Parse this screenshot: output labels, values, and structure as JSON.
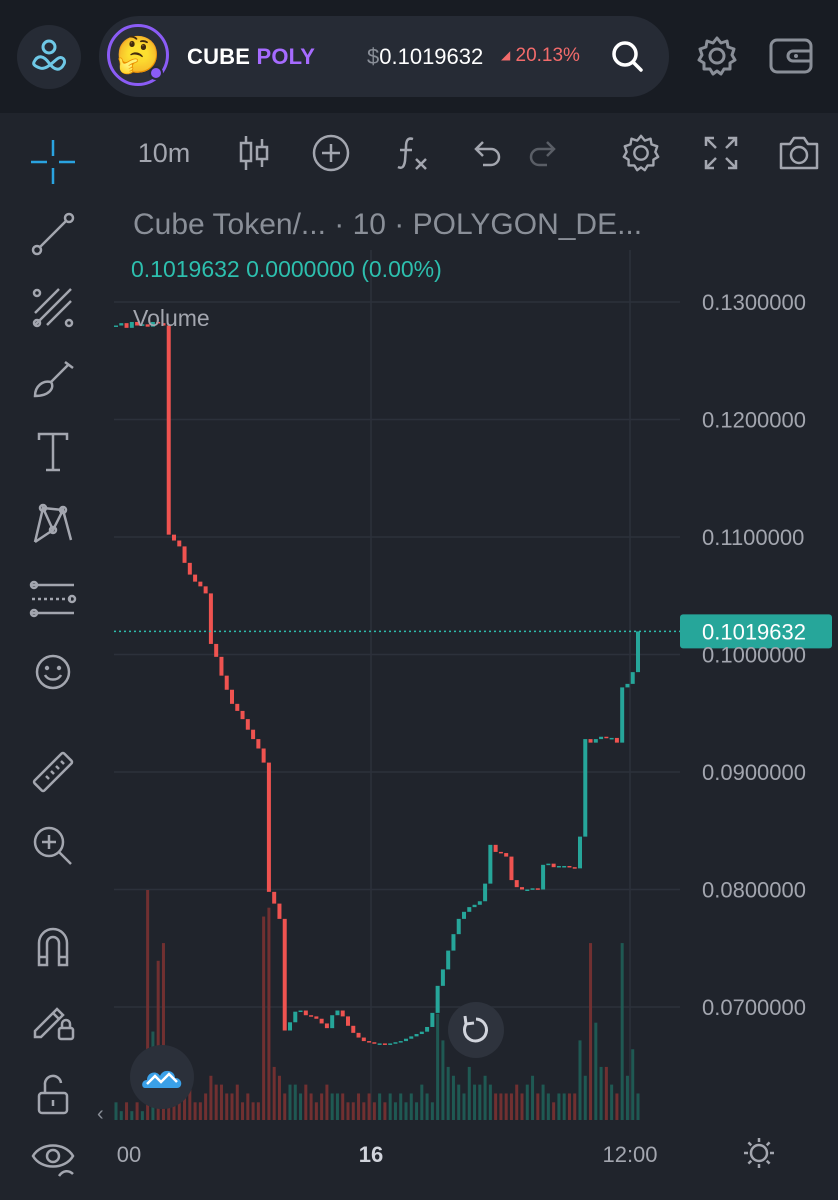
{
  "header": {
    "token_symbol": "CUBE",
    "token_chain": "POLY",
    "price_currency": "$",
    "price": "0.1019632",
    "change_arrow": "◢",
    "change": "20.13%",
    "avatar_emoji": "🤔"
  },
  "toolbar": {
    "interval": "10m"
  },
  "chart_header": {
    "title": "Cube Token/...  ·  10  ·  POLYGON_DE...",
    "ohlc": "0.1019632  0.0000000 (0.00%)",
    "volume_label": "Volume"
  },
  "chart_data": {
    "type": "candlestick",
    "pair_label": "Cube Token/...",
    "interval": "10",
    "exchange": "POLYGON_DE...",
    "last_price": "0.1019632",
    "last_price_value": 0.1019632,
    "ylim": [
      0.0625,
      0.1335
    ],
    "yticks": [
      "0.1300000",
      "0.1200000",
      "0.1100000",
      "0.1000000",
      "0.0900000",
      "0.0800000",
      "0.0700000"
    ],
    "ytick_values": [
      0.13,
      0.12,
      0.11,
      0.1,
      0.09,
      0.08,
      0.07
    ],
    "xticks": [
      "00",
      "16",
      "12:00"
    ],
    "xtick_bold": [
      false,
      true,
      false
    ],
    "bar_count": 100,
    "series": [
      {
        "name": "Price",
        "close": [
          0.128,
          0.1282,
          0.1278,
          0.1283,
          0.128,
          0.1281,
          0.1279,
          0.1283,
          0.1282,
          0.128,
          0.1102,
          0.1097,
          0.1092,
          0.1078,
          0.1068,
          0.1062,
          0.1058,
          0.1052,
          0.1009,
          0.0998,
          0.0982,
          0.097,
          0.0958,
          0.0952,
          0.0945,
          0.0936,
          0.0928,
          0.092,
          0.0908,
          0.0798,
          0.0788,
          0.0775,
          0.068,
          0.0687,
          0.0696,
          0.0697,
          0.0693,
          0.0692,
          0.069,
          0.0686,
          0.0682,
          0.0693,
          0.0697,
          0.0692,
          0.0684,
          0.0678,
          0.0674,
          0.0671,
          0.067,
          0.0669,
          0.0669,
          0.0668,
          0.0669,
          0.067,
          0.0671,
          0.0673,
          0.0675,
          0.0677,
          0.0679,
          0.0683,
          0.0695,
          0.0718,
          0.0732,
          0.0748,
          0.0762,
          0.0775,
          0.0781,
          0.0785,
          0.0787,
          0.079,
          0.0805,
          0.0838,
          0.0832,
          0.0831,
          0.0828,
          0.0808,
          0.0802,
          0.08,
          0.08,
          0.0801,
          0.08,
          0.0821,
          0.0822,
          0.0819,
          0.082,
          0.082,
          0.0819,
          0.0818,
          0.0845,
          0.0928,
          0.0925,
          0.0928,
          0.093,
          0.0929,
          0.0929,
          0.0925,
          0.0972,
          0.0975,
          0.0985,
          0.1019632
        ],
        "volume": [
          2,
          1,
          2,
          1,
          2,
          1,
          26,
          10,
          18,
          20,
          4,
          3,
          5,
          3,
          4,
          2,
          2,
          3,
          5,
          4,
          4,
          3,
          3,
          4,
          2,
          3,
          2,
          2,
          23,
          24,
          6,
          5,
          3,
          4,
          4,
          3,
          4,
          3,
          2,
          3,
          4,
          3,
          3,
          3,
          2,
          2,
          3,
          2,
          3,
          2,
          3,
          2,
          3,
          2,
          3,
          2,
          3,
          2,
          4,
          3,
          2,
          12,
          9,
          6,
          5,
          4,
          3,
          6,
          4,
          4,
          5,
          4,
          3,
          3,
          3,
          3,
          4,
          3,
          4,
          5,
          3,
          4,
          3,
          2,
          3,
          3,
          3,
          3,
          9,
          5,
          20,
          11,
          6,
          6,
          4,
          3,
          20,
          5,
          8,
          3,
          4,
          4
        ]
      }
    ]
  }
}
